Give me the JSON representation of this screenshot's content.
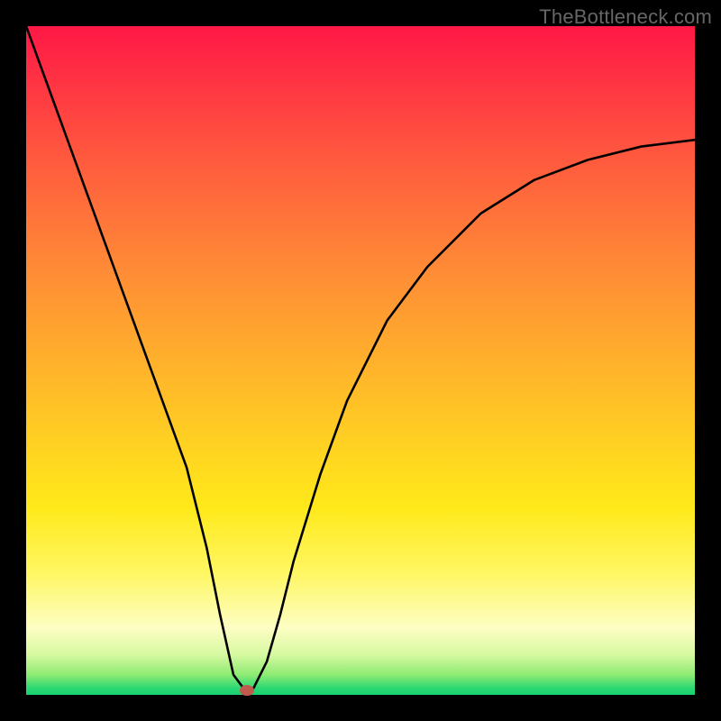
{
  "watermark": "TheBottleneck.com",
  "chart_data": {
    "type": "line",
    "title": "",
    "xlabel": "",
    "ylabel": "",
    "xlim": [
      0,
      100
    ],
    "ylim": [
      0,
      100
    ],
    "grid": false,
    "legend": false,
    "background_gradient": {
      "direction": "vertical",
      "stops": [
        {
          "pos": 0.0,
          "color": "#ff1846"
        },
        {
          "pos": 0.2,
          "color": "#ff5a3e"
        },
        {
          "pos": 0.5,
          "color": "#ffb02c"
        },
        {
          "pos": 0.72,
          "color": "#ffe91a"
        },
        {
          "pos": 0.9,
          "color": "#fdfec4"
        },
        {
          "pos": 1.0,
          "color": "#18d070"
        }
      ]
    },
    "series": [
      {
        "name": "bottleneck-curve",
        "color": "#000000",
        "x": [
          0,
          4,
          8,
          12,
          16,
          20,
          24,
          27,
          29,
          31,
          32.5,
          34,
          36,
          38,
          40,
          44,
          48,
          54,
          60,
          68,
          76,
          84,
          92,
          100
        ],
        "y": [
          100,
          89,
          78,
          67,
          56,
          45,
          34,
          22,
          12,
          3,
          1,
          1,
          5,
          12,
          20,
          33,
          44,
          56,
          64,
          72,
          77,
          80,
          82,
          83
        ]
      }
    ],
    "marker": {
      "name": "optimal-point",
      "x": 33.0,
      "y": 0.7,
      "color": "#c05a4e"
    }
  }
}
